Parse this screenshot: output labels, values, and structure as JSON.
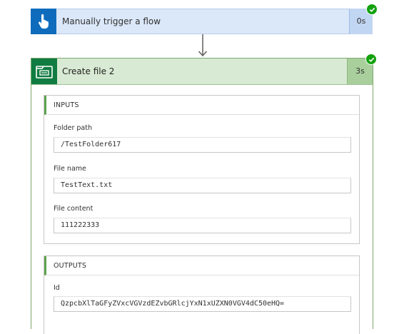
{
  "trigger": {
    "title": "Manually trigger a flow",
    "duration": "0s",
    "icon": "hand-tap-icon",
    "status": "succeeded",
    "accent": "#0f6cbd"
  },
  "action": {
    "title": "Create file 2",
    "duration": "3s",
    "icon": "sharepoint-file-icon",
    "status": "succeeded",
    "accent": "#107c41"
  },
  "inputs": {
    "header": "INPUTS",
    "fields": [
      {
        "label": "Folder path",
        "value": "/TestFolder617"
      },
      {
        "label": "File name",
        "value": "TestText.txt"
      },
      {
        "label": "File content",
        "value": "111222333"
      }
    ]
  },
  "outputs": {
    "header": "OUTPUTS",
    "fields": [
      {
        "label": "Id",
        "value": "QzpcbXlTaGFyZVxcVGVzdEZvbGRlcjYxN1xUZXN0VGV4dC50eHQ="
      }
    ]
  }
}
